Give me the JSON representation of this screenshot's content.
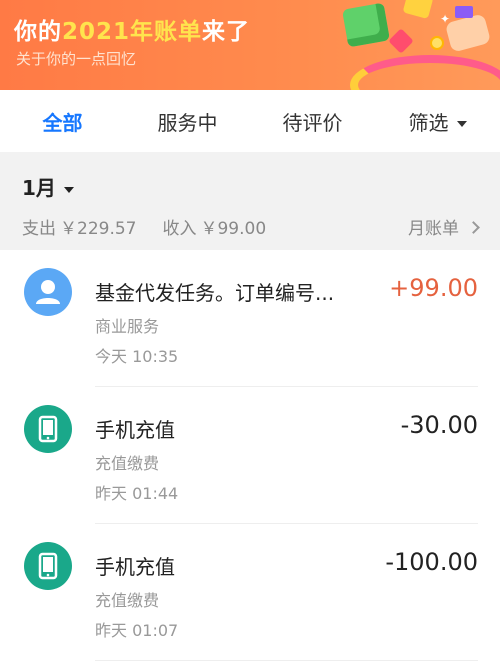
{
  "banner": {
    "title_prefix": "你的",
    "title_highlight": "2021年账单",
    "title_suffix": "来了",
    "subtitle": "关于你的一点回忆"
  },
  "tabs": [
    {
      "label": "全部",
      "active": true
    },
    {
      "label": "服务中",
      "active": false
    },
    {
      "label": "待评价",
      "active": false
    },
    {
      "label": "筛选",
      "active": false
    }
  ],
  "summary": {
    "month": "1月",
    "expense_label": "支出",
    "expense_value": "￥229.57",
    "income_label": "收入",
    "income_value": "￥99.00",
    "monthly_bill": "月账单"
  },
  "transactions": [
    {
      "title": "基金代发任务。订单编号...",
      "amount": "+99.00",
      "category": "商业服务",
      "time": "今天  10:35",
      "icon": "person-icon",
      "color": "#e5623f"
    },
    {
      "title": "手机充值",
      "amount": "-30.00",
      "category": "充值缴费",
      "time": "昨天  01:44",
      "icon": "phone-icon",
      "color": "#222222"
    },
    {
      "title": "手机充值",
      "amount": "-100.00",
      "category": "充值缴费",
      "time": "昨天  01:07",
      "icon": "phone-icon",
      "color": "#222222"
    }
  ],
  "colors": {
    "accent": "#1677ff",
    "banner": "#ff7a45",
    "income": "#e5623f",
    "phone_icon_bg": "#1aa88a",
    "person_icon_bg": "#5ba8f5"
  }
}
